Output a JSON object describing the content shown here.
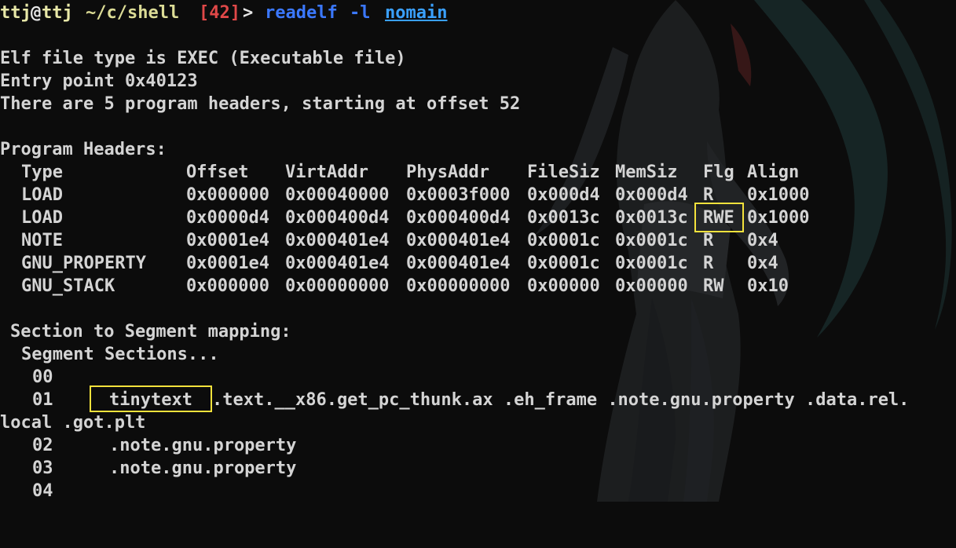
{
  "prompt": {
    "user": "ttj",
    "at": "@",
    "host": "ttj",
    "path": "~/c/shell",
    "status": "[42]",
    "symbol": ">",
    "command": "readelf",
    "flag": "-l",
    "arg": "nomain"
  },
  "header": {
    "file_type": "Elf file type is EXEC (Executable file)",
    "entry": "Entry point 0x40123",
    "count": "There are 5 program headers, starting at offset 52"
  },
  "program_headers": {
    "title": "Program Headers:",
    "columns": [
      "Type",
      "Offset",
      "VirtAddr",
      "PhysAddr",
      "FileSiz",
      "MemSiz",
      "Flg",
      "Align"
    ],
    "rows": [
      [
        "LOAD",
        "0x000000",
        "0x00040000",
        "0x0003f000",
        "0x000d4",
        "0x000d4",
        "R",
        "0x1000"
      ],
      [
        "LOAD",
        "0x0000d4",
        "0x000400d4",
        "0x000400d4",
        "0x0013c",
        "0x0013c",
        "RWE",
        "0x1000"
      ],
      [
        "NOTE",
        "0x0001e4",
        "0x000401e4",
        "0x000401e4",
        "0x0001c",
        "0x0001c",
        "R",
        "0x4"
      ],
      [
        "GNU_PROPERTY",
        "0x0001e4",
        "0x000401e4",
        "0x000401e4",
        "0x0001c",
        "0x0001c",
        "R",
        "0x4"
      ],
      [
        "GNU_STACK",
        "0x000000",
        "0x00000000",
        "0x00000000",
        "0x00000",
        "0x00000",
        "RW",
        "0x10"
      ]
    ]
  },
  "mapping": {
    "title": "Section to Segment mapping:",
    "header": "Segment Sections...",
    "rows": [
      {
        "seg": "00",
        "sections": ""
      },
      {
        "seg": "01",
        "highlight": "tinytext",
        "sections": ".text.__x86.get_pc_thunk.ax .eh_frame .note.gnu.property .data.rel.",
        "wrap": "local .got.plt"
      },
      {
        "seg": "02",
        "sections": ".note.gnu.property"
      },
      {
        "seg": "03",
        "sections": ".note.gnu.property"
      },
      {
        "seg": "04",
        "sections": ""
      }
    ]
  },
  "colors": {
    "background": "#0c0c0c",
    "text": "#d4d4d4",
    "command": "#3b78ff",
    "status": "#e04848",
    "highlight_box": "#f4e23c"
  }
}
